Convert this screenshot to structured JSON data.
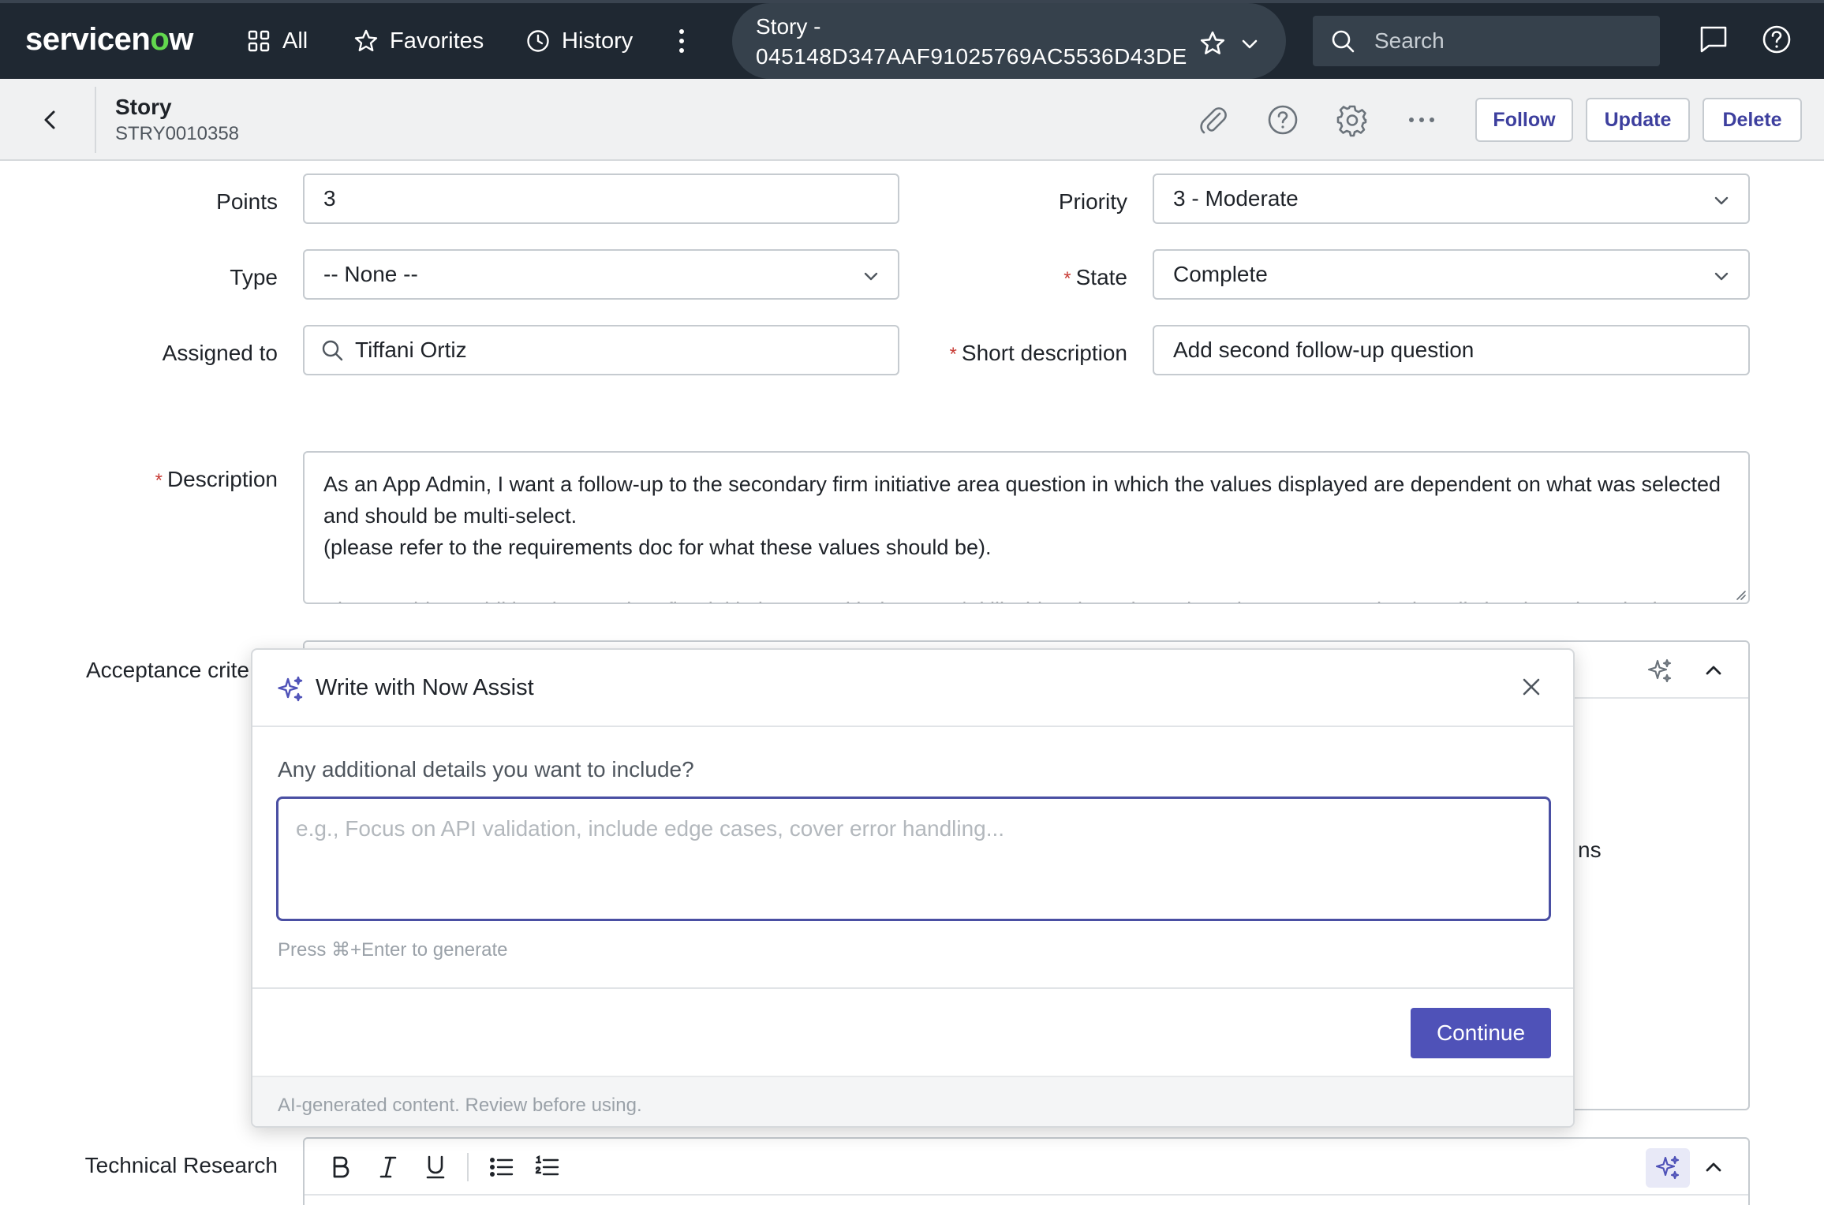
{
  "nav": {
    "logo": "servicenow",
    "all_label": "All",
    "favorites_label": "Favorites",
    "history_label": "History",
    "story_pill_line1": "Story -",
    "story_pill_line2": "045148D347AAF91025769AC5536D43DE",
    "search_placeholder": "Search"
  },
  "record": {
    "title": "Story",
    "number": "STRY0010358",
    "buttons": {
      "follow": "Follow",
      "update": "Update",
      "delete": "Delete"
    }
  },
  "form": {
    "points": {
      "label": "Points",
      "value": "3"
    },
    "priority": {
      "label": "Priority",
      "value": "3 - Moderate"
    },
    "type": {
      "label": "Type",
      "value": "-- None --"
    },
    "state": {
      "label": "State",
      "value": "Complete",
      "required": "*"
    },
    "assigned_to": {
      "label": "Assigned to",
      "value": "Tiffani Ortiz"
    },
    "short_description": {
      "label": "Short description",
      "value": "Add second follow-up question",
      "required": "*"
    },
    "description": {
      "label": "Description",
      "required": "*",
      "value": "As an App Admin, I want a follow-up to the secondary firm initiative area question in which the values displayed are dependent on what was selected and should be multi-select.\n(please refer to the requirements doc for what these values should be).\n\nPlease add an additional secondary firm initiative area titled Legacy/SkillBridge, based on what's been sent, as that is a distinct item than the last"
    },
    "acceptance_criteria": {
      "label": "Acceptance crite"
    },
    "technical_research": {
      "label": "Technical Research"
    },
    "background_peek": "ns"
  },
  "assist_dialog": {
    "title": "Write with Now Assist",
    "prompt": "Any additional details you want to include?",
    "placeholder": "e.g., Focus on API validation, include edge cases, cover error handling...",
    "hint": "Press ⌘+Enter to generate",
    "continue_label": "Continue",
    "footer": "AI-generated content. Review before using."
  },
  "colors": {
    "nav_bg": "#1f2832",
    "accent": "#4f52b8",
    "required": "#c83c36",
    "logo_green": "#62d84e"
  }
}
